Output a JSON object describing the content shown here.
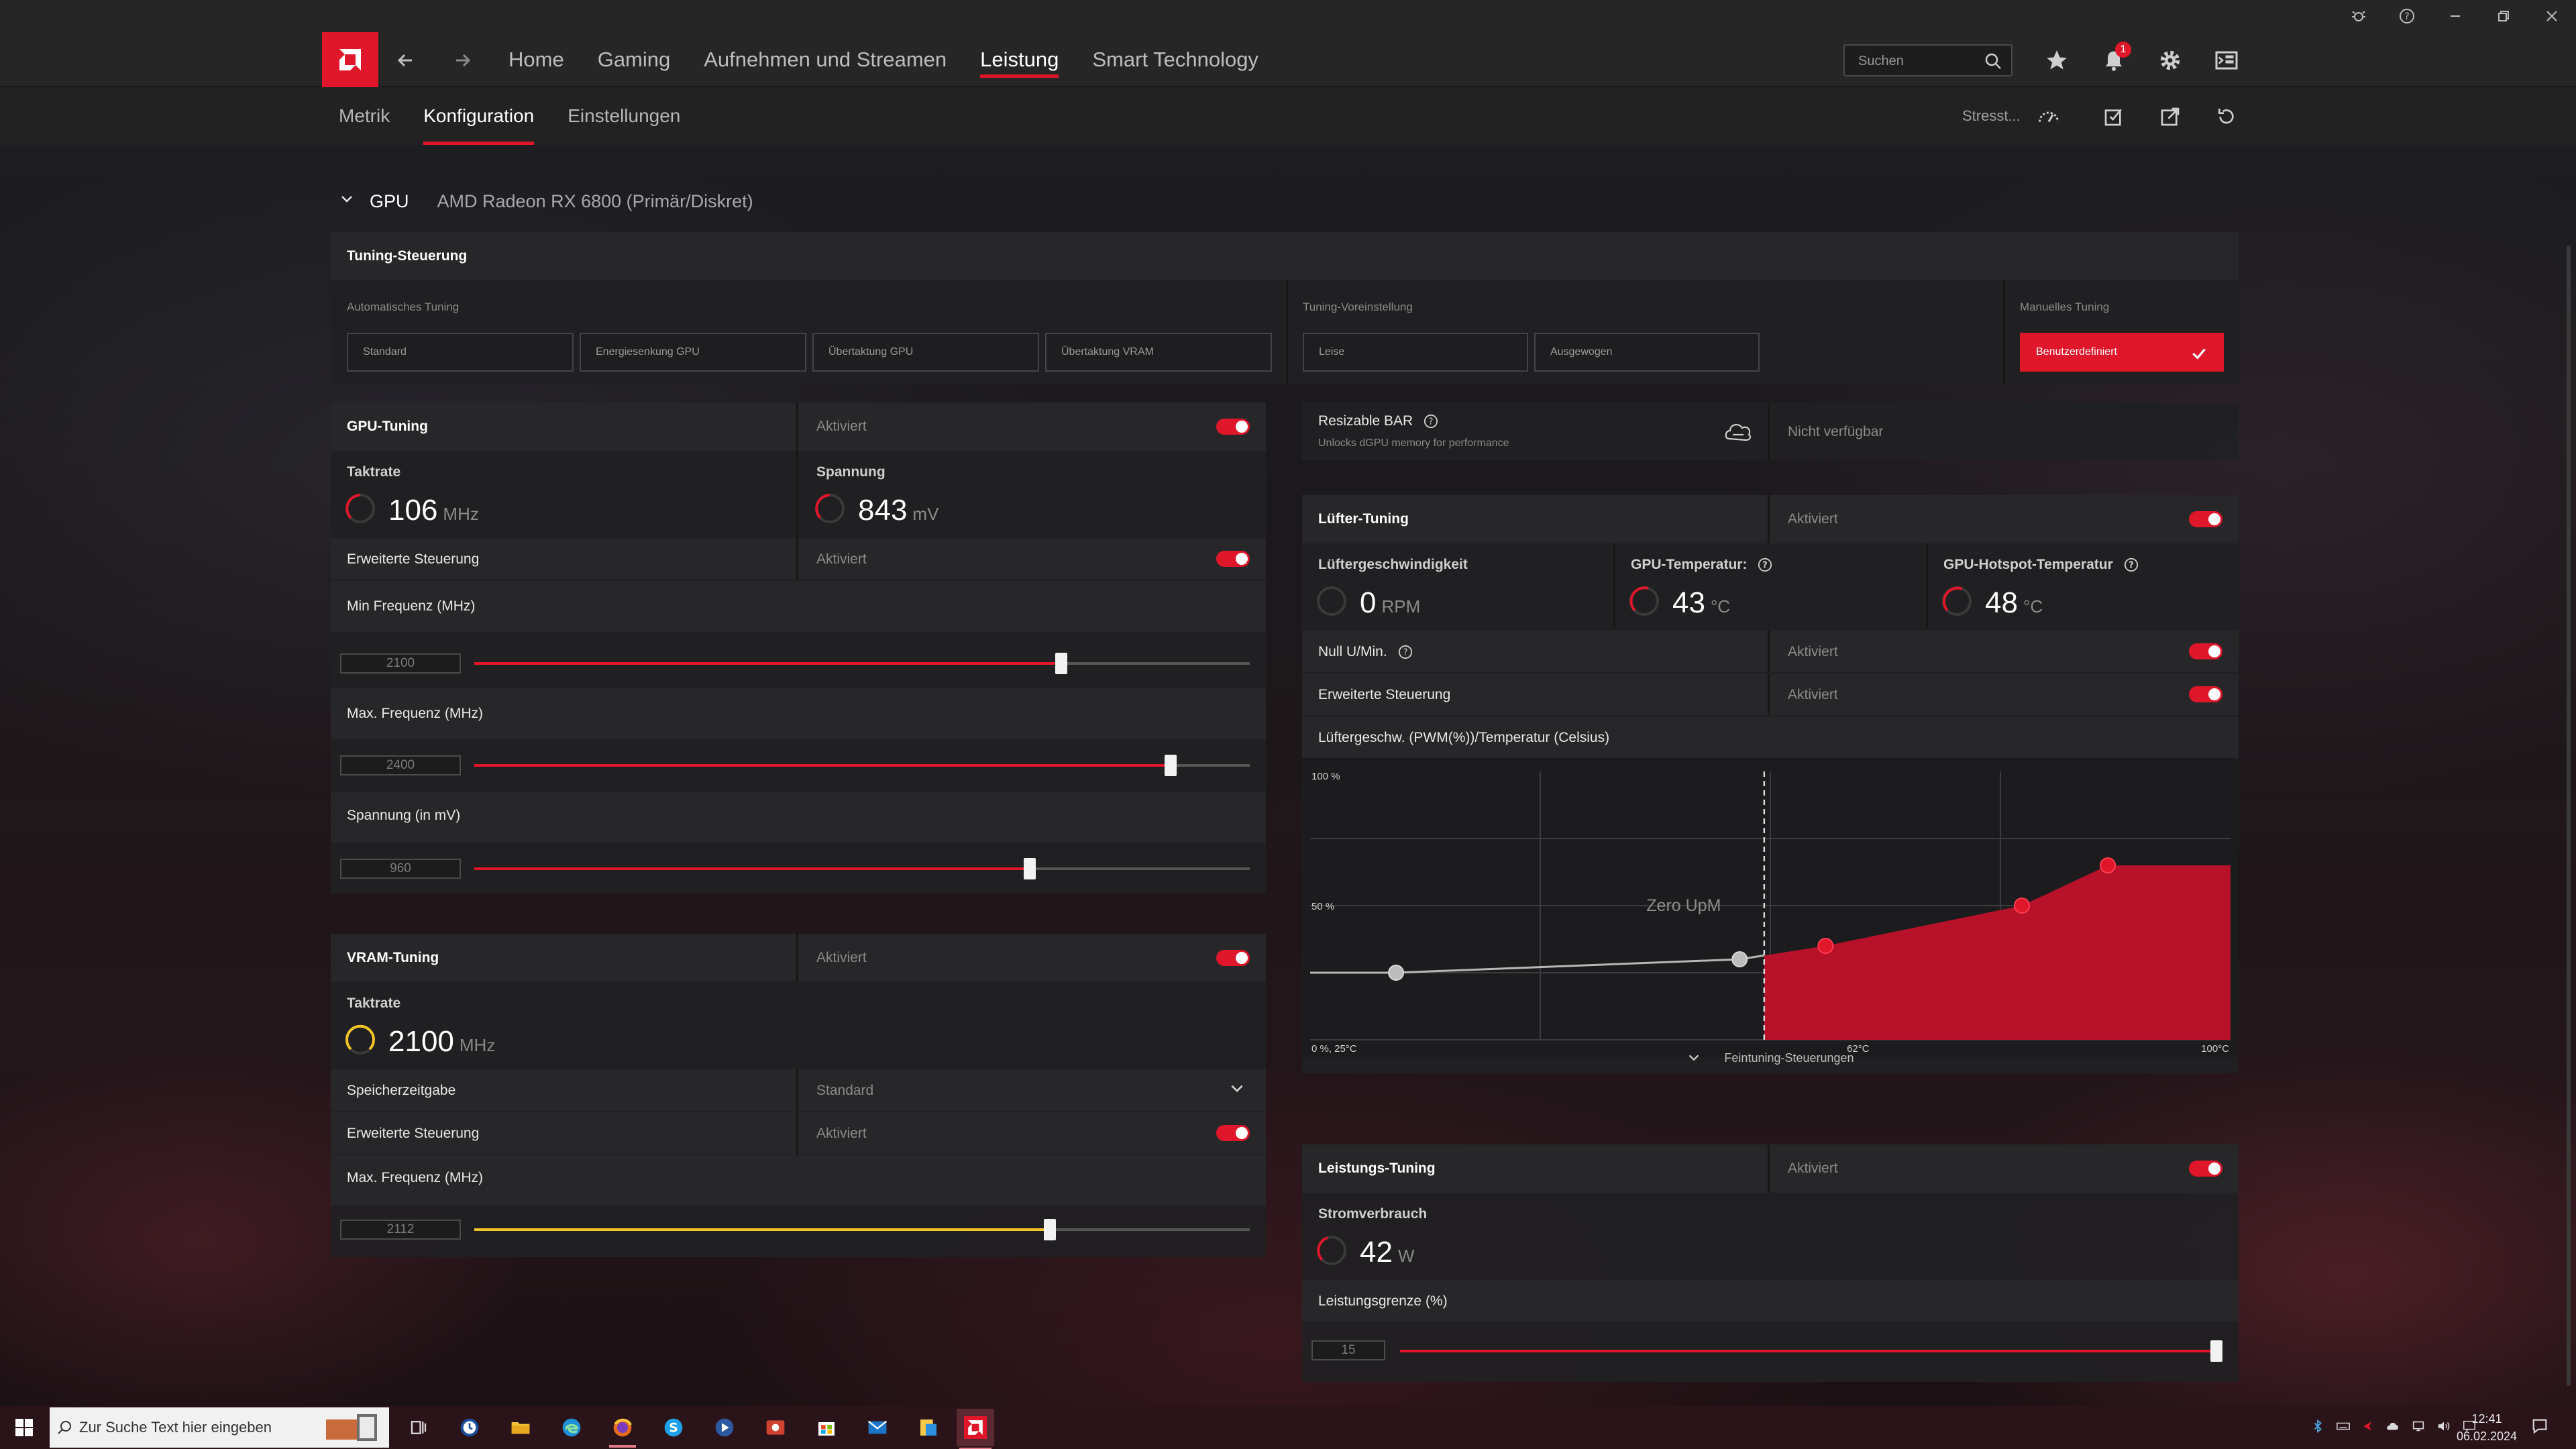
{
  "colors": {
    "accent": "#e0162b",
    "accent_yellow": "#f3c428",
    "panel": "#202022"
  },
  "titlebar": {
    "icons": [
      "bug-report-icon",
      "help-icon",
      "minimize-icon",
      "restore-icon",
      "close-icon"
    ]
  },
  "nav": {
    "items": [
      {
        "label": "Home"
      },
      {
        "label": "Gaming"
      },
      {
        "label": "Aufnehmen und Streamen"
      },
      {
        "label": "Leistung",
        "active": true
      },
      {
        "label": "Smart Technology"
      }
    ],
    "search_placeholder": "Suchen",
    "notification_count": "1"
  },
  "subnav": {
    "items": [
      {
        "label": "Metrik"
      },
      {
        "label": "Konfiguration",
        "active": true
      },
      {
        "label": "Einstellungen"
      }
    ],
    "stress_label": "Stresst..."
  },
  "gpu": {
    "label": "GPU",
    "name": "AMD Radeon RX 6800 (Primär/Diskret)"
  },
  "tuning_control": {
    "title": "Tuning-Steuerung",
    "auto_label": "Automatisches Tuning",
    "auto_buttons": [
      "Standard",
      "Energiesenkung GPU",
      "Übertaktung GPU",
      "Übertaktung VRAM"
    ],
    "preset_label": "Tuning-Voreinstellung",
    "preset_buttons": [
      "Leise",
      "Ausgewogen"
    ],
    "manual_label": "Manuelles Tuning",
    "manual_button": "Benutzerdefiniert"
  },
  "gpu_tuning": {
    "title": "GPU-Tuning",
    "status": "Aktiviert",
    "clock_label": "Taktrate",
    "clock_value": "106",
    "clock_unit": "MHz",
    "voltage_label": "Spannung",
    "voltage_value": "843",
    "voltage_unit": "mV",
    "advanced_label": "Erweiterte Steuerung",
    "advanced_status": "Aktiviert",
    "min_freq_label": "Min Frequenz (MHz)",
    "min_freq_value": "2100",
    "min_freq_fraction": 0.757,
    "max_freq_label": "Max. Frequenz (MHz)",
    "max_freq_value": "2400",
    "max_freq_fraction": 0.898,
    "volt_label": "Spannung (in mV)",
    "volt_value": "960",
    "volt_fraction": 0.716
  },
  "vram_tuning": {
    "title": "VRAM-Tuning",
    "status": "Aktiviert",
    "clock_label": "Taktrate",
    "clock_value": "2100",
    "clock_unit": "MHz",
    "timing_label": "Speicherzeitgabe",
    "timing_value": "Standard",
    "advanced_label": "Erweiterte Steuerung",
    "advanced_status": "Aktiviert",
    "max_freq_label": "Max. Frequenz (MHz)",
    "max_freq_value": "2112",
    "max_freq_fraction": 0.742
  },
  "resizable_bar": {
    "title": "Resizable BAR",
    "subtitle": "Unlocks dGPU memory for performance",
    "status": "Nicht verfügbar"
  },
  "fan_tuning": {
    "title": "Lüfter-Tuning",
    "status": "Aktiviert",
    "fan_speed_label": "Lüftergeschwindigkeit",
    "fan_speed_value": "0",
    "fan_speed_unit": "RPM",
    "gpu_temp_label": "GPU-Temperatur:",
    "gpu_temp_value": "43",
    "gpu_temp_unit": "°C",
    "hotspot_label": "GPU-Hotspot-Temperatur",
    "hotspot_value": "48",
    "hotspot_unit": "°C",
    "zero_rpm_label": "Null U/Min.",
    "zero_rpm_status": "Aktiviert",
    "advanced_label": "Erweiterte Steuerung",
    "advanced_status": "Aktiviert",
    "curve_label": "Lüftergeschw. (PWM(%))/Temperatur (Celsius)",
    "fine_tuning_label": "Feintuning-Steuerungen"
  },
  "chart_data": {
    "type": "area",
    "title": "Lüftergeschw. (PWM(%))/Temperatur (Celsius)",
    "y_tick_labels": [
      "100 %",
      "50 %",
      "0 %, 25°C"
    ],
    "x_tick_labels": [
      "62°C",
      "100°C"
    ],
    "annotation": "Zero UpM",
    "xlim": [
      25,
      100
    ],
    "ylim": [
      0,
      100
    ],
    "zero_rpm_threshold": 62,
    "series": [
      {
        "points": [
          {
            "x": 32,
            "y": 25
          },
          {
            "x": 60,
            "y": 30
          },
          {
            "x": 67,
            "y": 35
          },
          {
            "x": 83,
            "y": 50
          },
          {
            "x": 90,
            "y": 65
          }
        ]
      }
    ]
  },
  "power_tuning": {
    "title": "Leistungs-Tuning",
    "status": "Aktiviert",
    "consumption_label": "Stromverbrauch",
    "consumption_value": "42",
    "consumption_unit": "W",
    "limit_label": "Leistungsgrenze (%)",
    "limit_value": "15",
    "limit_fraction": 1.0
  },
  "taskbar": {
    "search_placeholder": "Zur Suche Text hier eingeben",
    "time": "12:41",
    "date": "06.02.2024"
  }
}
